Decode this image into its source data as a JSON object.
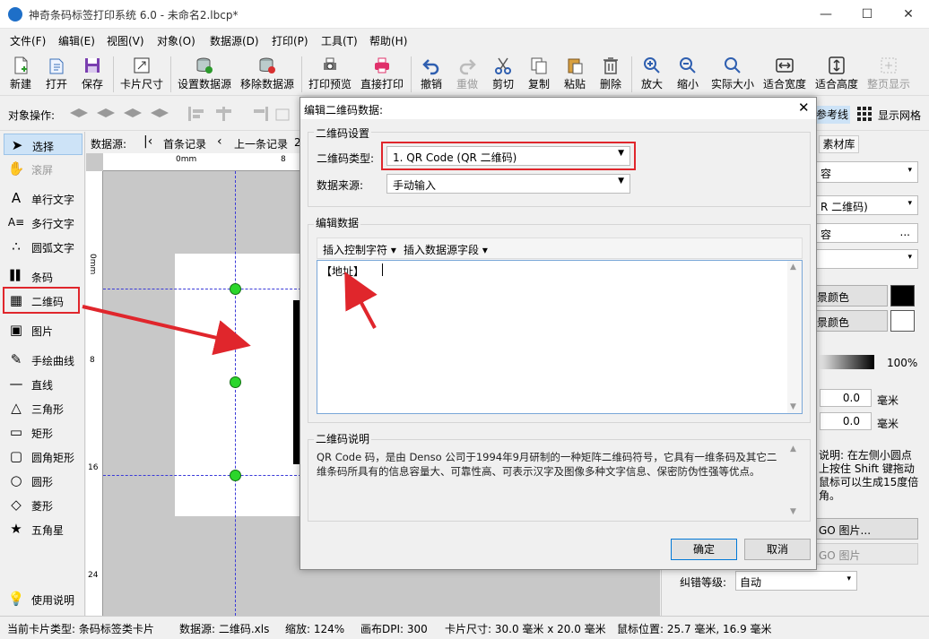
{
  "window": {
    "title": "神奇条码标签打印系统 6.0 - 未命名2.lbcp*",
    "minimize": "—",
    "maximize": "☐",
    "close": "✕"
  },
  "menu": [
    "文件(F)",
    "编辑(E)",
    "视图(V)",
    "对象(O)",
    "数据源(D)",
    "打印(P)",
    "工具(T)",
    "帮助(H)"
  ],
  "toolbar": [
    {
      "label": "新建",
      "icon": "new-file-icon"
    },
    {
      "label": "打开",
      "icon": "open-icon"
    },
    {
      "label": "保存",
      "icon": "save-icon"
    },
    {
      "label": "卡片尺寸",
      "icon": "card-size-icon"
    },
    {
      "label": "设置数据源",
      "icon": "database-set-icon"
    },
    {
      "label": "移除数据源",
      "icon": "database-remove-icon"
    },
    {
      "label": "打印预览",
      "icon": "print-preview-icon"
    },
    {
      "label": "直接打印",
      "icon": "printer-icon"
    },
    {
      "label": "撤销",
      "icon": "undo-icon"
    },
    {
      "label": "重做",
      "icon": "redo-icon"
    },
    {
      "label": "剪切",
      "icon": "cut-icon"
    },
    {
      "label": "复制",
      "icon": "copy-icon"
    },
    {
      "label": "粘贴",
      "icon": "paste-icon"
    },
    {
      "label": "删除",
      "icon": "delete-icon"
    },
    {
      "label": "放大",
      "icon": "zoom-in-icon"
    },
    {
      "label": "缩小",
      "icon": "zoom-out-icon"
    },
    {
      "label": "实际大小",
      "icon": "actual-size-icon"
    },
    {
      "label": "适合宽度",
      "icon": "fit-width-icon"
    },
    {
      "label": "适合高度",
      "icon": "fit-height-icon"
    },
    {
      "label": "整页显示",
      "icon": "full-page-icon"
    }
  ],
  "objbar": {
    "label": "对象操作:",
    "ref_lines": "参考线",
    "show_grid": "显示网格"
  },
  "tools": [
    {
      "label": "选择",
      "glyph": "➤"
    },
    {
      "label": "滚屏",
      "glyph": "✋"
    },
    {
      "label": "单行文字",
      "glyph": "A"
    },
    {
      "label": "多行文字",
      "glyph": "A≡"
    },
    {
      "label": "圆弧文字",
      "glyph": "∴"
    },
    {
      "label": "条码",
      "glyph": "▌▌"
    },
    {
      "label": "二维码",
      "glyph": "▦"
    },
    {
      "label": "图片",
      "glyph": "▣"
    },
    {
      "label": "手绘曲线",
      "glyph": "✎"
    },
    {
      "label": "直线",
      "glyph": "—"
    },
    {
      "label": "三角形",
      "glyph": "△"
    },
    {
      "label": "矩形",
      "glyph": "▭"
    },
    {
      "label": "圆角矩形",
      "glyph": "▢"
    },
    {
      "label": "圆形",
      "glyph": "○"
    },
    {
      "label": "菱形",
      "glyph": "◇"
    },
    {
      "label": "五角星",
      "glyph": "★"
    },
    {
      "label": "使用说明",
      "glyph": "💡"
    }
  ],
  "nav": {
    "datasource": "数据源:",
    "first": "首条记录",
    "prev": "上一条记录",
    "extra": "2"
  },
  "ruler": {
    "top0": "0mm",
    "top8": "8",
    "l0": "0mm",
    "l8": "8",
    "l16": "16",
    "l24": "24"
  },
  "right": {
    "tab": "素材库",
    "content": "容",
    "qr_type": "R 二维码)",
    "attr": "容",
    "dots": "...",
    "color1": "景颜色",
    "color2": "景颜色",
    "opacity": "100%",
    "v1": "0.0",
    "v2": "0.0",
    "unit": "毫米",
    "hint": "说明: 在左侧小圆点上按住 Shift 键拖动鼠标可以生成15度倍角。",
    "logo1": "GO 图片...",
    "logo2": "GO 图片",
    "ecc_label": "纠错等级:",
    "ecc_value": "自动"
  },
  "dialog": {
    "title": "编辑二维码数据:",
    "group1": "二维码设置",
    "type_label": "二维码类型:",
    "type_value": "1. QR Code (QR 二维码)",
    "src_label": "数据来源:",
    "src_value": "手动输入",
    "group2": "编辑数据",
    "insert_ctrl": "插入控制字符",
    "insert_field": "插入数据源字段",
    "content": "【地址】",
    "group3": "二维码说明",
    "desc": "QR Code 码，是由 Denso 公司于1994年9月研制的一种矩阵二维码符号，它具有一维条码及其它二维条码所具有的信息容量大、可靠性高、可表示汉字及图像多种文字信息、保密防伪性强等优点。",
    "ok": "确定",
    "cancel": "取消"
  },
  "status": {
    "card_type": "当前卡片类型: 条码标签类卡片",
    "datasource": "数据源: 二维码.xls",
    "zoom": "缩放: 124%",
    "dpi": "画布DPI: 300",
    "size": "卡片尺寸: 30.0 毫米 x 20.0 毫米",
    "mouse": "鼠标位置: 25.7 毫米, 16.9 毫米"
  },
  "colors": {
    "accent": "#e0262c",
    "title_blue": "#1e6fc8"
  }
}
